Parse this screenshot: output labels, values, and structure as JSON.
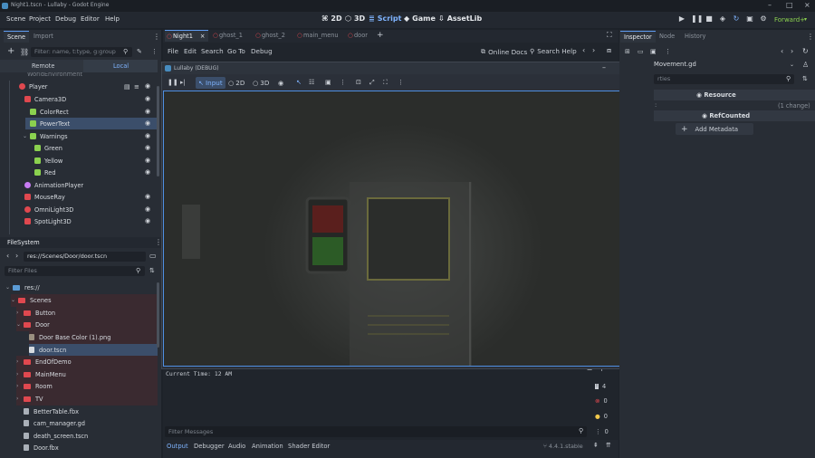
{
  "window": {
    "title": "Night1.tscn - Lullaby - Godot Engine"
  },
  "menu": [
    "Scene",
    "Project",
    "Debug",
    "Editor",
    "Help"
  ],
  "modes": [
    {
      "label": "2D",
      "icon": "2d-icon"
    },
    {
      "label": "3D",
      "icon": "3d-icon"
    },
    {
      "label": "Script",
      "icon": "script-icon",
      "active": true
    },
    {
      "label": "Game",
      "icon": "game-icon"
    },
    {
      "label": "AssetLib",
      "icon": "assetlib-icon"
    }
  ],
  "renderer": "Forward+",
  "scene_dock": {
    "tabs": [
      "Scene",
      "Import"
    ],
    "filter_placeholder": "Filter: name, t:type, g:group",
    "remote": "Remote",
    "local": "Local",
    "partial_item": "WorldEnvironment",
    "items": [
      {
        "label": "Player",
        "color": "#e0484f"
      },
      {
        "label": "Camera3D",
        "color": "#e0484f"
      },
      {
        "label": "ColorRect",
        "color": "#8bd14f"
      },
      {
        "label": "PowerText",
        "color": "#8bd14f",
        "selected": true
      },
      {
        "label": "Warnings",
        "color": "#8bd14f"
      },
      {
        "label": "Green",
        "color": "#8bd14f"
      },
      {
        "label": "Yellow",
        "color": "#8bd14f"
      },
      {
        "label": "Red",
        "color": "#8bd14f"
      },
      {
        "label": "AnimationPlayer",
        "color": "#c77bf2"
      },
      {
        "label": "MouseRay",
        "color": "#e0484f"
      },
      {
        "label": "OmniLight3D",
        "color": "#e0484f"
      },
      {
        "label": "SpotLight3D",
        "color": "#e0484f"
      }
    ]
  },
  "filesystem": {
    "title": "FileSystem",
    "path": "res://Scenes/Door/door.tscn",
    "filter_placeholder": "Filter Files",
    "items": [
      {
        "label": "res://",
        "kind": "root"
      },
      {
        "label": "Scenes",
        "kind": "folder"
      },
      {
        "label": "Button",
        "kind": "folder"
      },
      {
        "label": "Door",
        "kind": "folder"
      },
      {
        "label": "Door Base Color (1).png",
        "kind": "image"
      },
      {
        "label": "door.tscn",
        "kind": "scene",
        "selected": true
      },
      {
        "label": "EndOfDemo",
        "kind": "folder"
      },
      {
        "label": "MainMenu",
        "kind": "folder"
      },
      {
        "label": "Room",
        "kind": "folder"
      },
      {
        "label": "TV",
        "kind": "folder"
      },
      {
        "label": "BetterTable.fbx",
        "kind": "file"
      },
      {
        "label": "cam_manager.gd",
        "kind": "file"
      },
      {
        "label": "death_screen.tscn",
        "kind": "file"
      },
      {
        "label": "Door.fbx",
        "kind": "file"
      }
    ]
  },
  "script_tabs": [
    "Night1",
    "ghost_1",
    "ghost_2",
    "main_menu",
    "door"
  ],
  "script_menu": [
    "File",
    "Edit",
    "Search",
    "Go To",
    "Debug"
  ],
  "online_docs": "Online Docs",
  "search_help": "Search Help",
  "game_window": {
    "title": "Lullaby (DEBUG)",
    "input_label": "Input",
    "mode_2d": "2D",
    "mode_3d": "3D",
    "resolution": "1152x648"
  },
  "output": {
    "text": "Current Time: 12 AM",
    "filter_placeholder": "Filter Messages"
  },
  "counts": {
    "messages": "4",
    "errors": "0",
    "warnings": "0",
    "info": "0"
  },
  "bottom_tabs": [
    "Output",
    "Debugger",
    "Audio",
    "Animation",
    "Shader Editor"
  ],
  "version": "4.4.1.stable",
  "inspector": {
    "tabs": [
      "Inspector",
      "Node",
      "History"
    ],
    "script": "Movement.gd",
    "filter_partial": "rties",
    "resource": "Resource",
    "changes": "(1 change)",
    "refcounted": "RefCounted",
    "add_metadata": "Add Metadata"
  }
}
